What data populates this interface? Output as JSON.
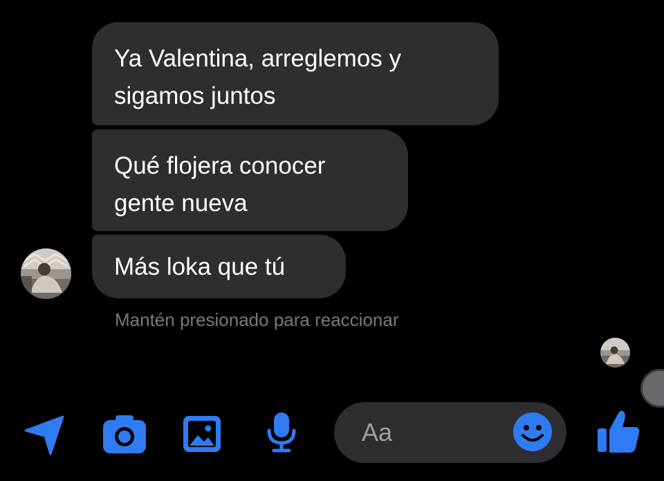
{
  "messages": [
    {
      "text_lines": [
        "Ya Valentina, arreglemos y",
        "sigamos juntos"
      ]
    },
    {
      "text_lines": [
        "Qué flojera conocer",
        "gente nueva"
      ]
    },
    {
      "text_lines": [
        "Más loka que tú"
      ]
    }
  ],
  "hint": "Mantén presionado para reaccionar",
  "composer": {
    "placeholder": "Aa"
  },
  "toolbar_icons": [
    "location-arrow-icon",
    "camera-icon",
    "image-icon",
    "microphone-icon",
    "emoji-icon",
    "thumbs-up-icon"
  ],
  "colors": {
    "accent": "#2f7bf2",
    "bubble": "#2e2e30",
    "background": "#000000",
    "hint_text": "#7a7a7e"
  }
}
